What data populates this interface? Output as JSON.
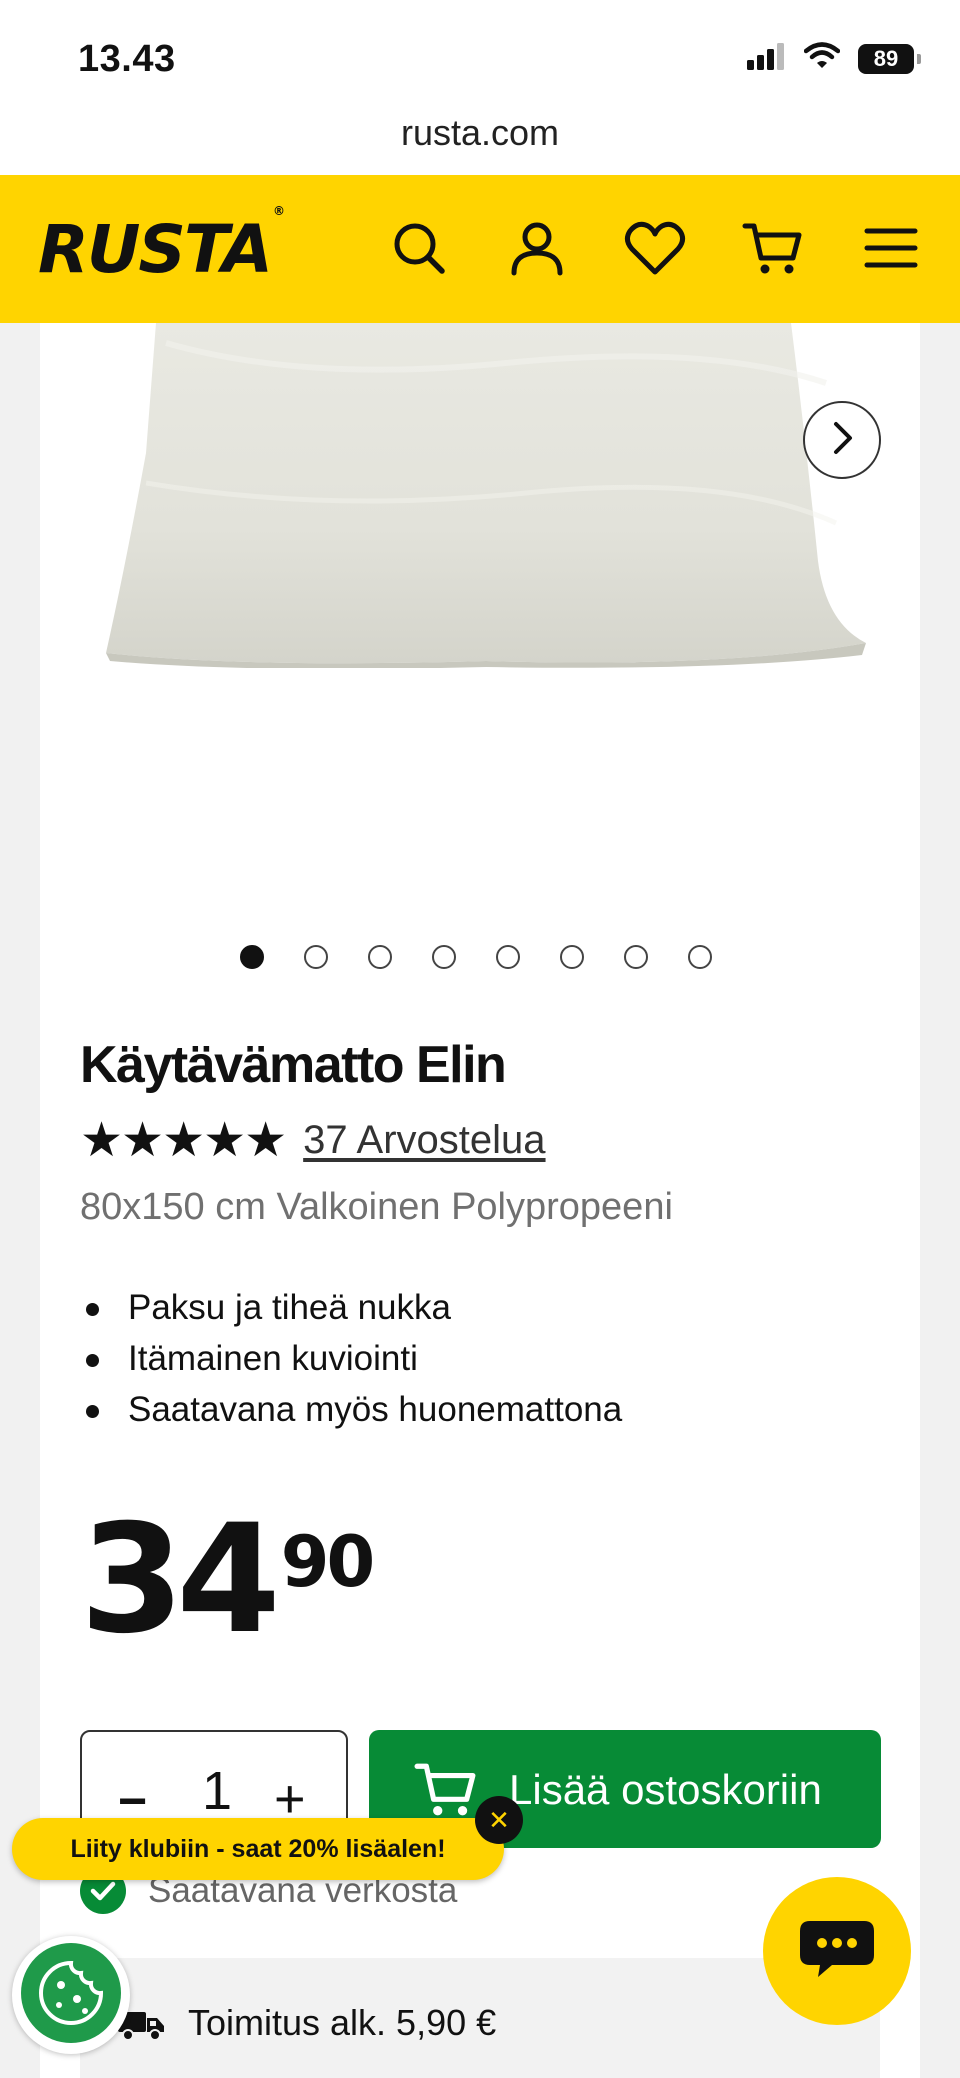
{
  "status_bar": {
    "time": "13.43",
    "battery": "89"
  },
  "browser": {
    "url": "rusta.com"
  },
  "header": {
    "logo": "RUSTA",
    "logo_mark": "®",
    "icons": [
      "search-icon",
      "account-icon",
      "heart-icon",
      "cart-icon",
      "menu-icon"
    ],
    "accent_color": "#ffd400"
  },
  "gallery": {
    "image_count": 8,
    "active_index": 0
  },
  "product": {
    "title": "Käytävämatto Elin",
    "stars": "★★★★★",
    "rating_stars": 5,
    "reviews_link": "37 Arvostelua",
    "subtitle": "80x150 cm Valkoinen Polypropeeni",
    "features": [
      "Paksu ja tiheä nukka",
      "Itämainen kuviointi",
      "Saatavana myös huonemattona"
    ],
    "price_main": "34",
    "price_decimals": "90"
  },
  "purchase": {
    "minus": "−",
    "quantity": "1",
    "plus": "+",
    "add_to_cart": "Lisää ostoskoriin",
    "button_color": "#078b36"
  },
  "availability": {
    "text": "Saatavana verkosta"
  },
  "club_banner": {
    "text": "Liity klubiin - saat 20% lisäalen!",
    "close": "✕"
  },
  "delivery": {
    "text": "Toimitus alk. 5,90 €"
  }
}
